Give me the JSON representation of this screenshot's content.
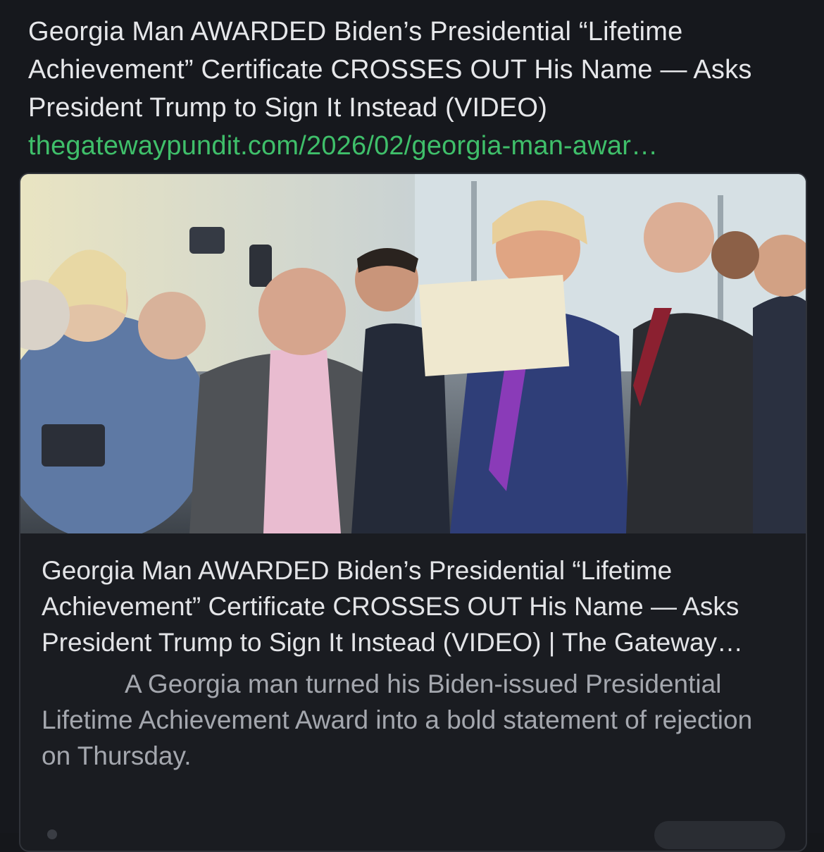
{
  "post": {
    "text": "Georgia Man AWARDED Biden’s Presidential “Lifetime Achievement” Certificate CROSSES OUT His Name — Asks President Trump to Sign It Instead (VIDEO)",
    "link": "thegatewaypundit.com/2026/02/georgia-man-awar…"
  },
  "card": {
    "image_icon": "photo-preview",
    "title": "Georgia Man AWARDED Biden’s Presidential “Lifetime Achievement” Certificate CROSSES OUT His Name — Asks President Trump to Sign It Instead (VIDEO) | The Gateway…",
    "description": "A Georgia man turned his Biden-issued Presidential Lifetime Achievement Award into a bold statement of rejection on Thursday."
  },
  "colors": {
    "background": "#16181d",
    "text": "#e6e7ea",
    "link": "#3fbf6a",
    "muted": "#a4a7ae",
    "card_border": "#30333a"
  }
}
